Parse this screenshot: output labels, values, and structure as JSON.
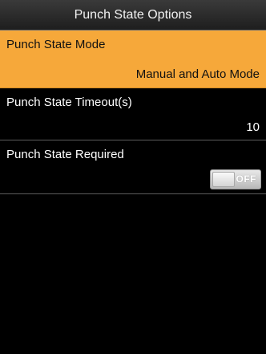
{
  "header": {
    "title": "Punch State Options"
  },
  "menu": {
    "items": [
      {
        "label": "Punch State Mode",
        "value": "Manual and Auto Mode",
        "selected": true
      },
      {
        "label": "Punch State Timeout(s)",
        "value": "10",
        "selected": false
      },
      {
        "label": "Punch State Required",
        "toggle_state": "OFF",
        "selected": false
      }
    ]
  },
  "colors": {
    "selection": "#f6a83a",
    "background": "#000000",
    "text": "#ffffff"
  }
}
